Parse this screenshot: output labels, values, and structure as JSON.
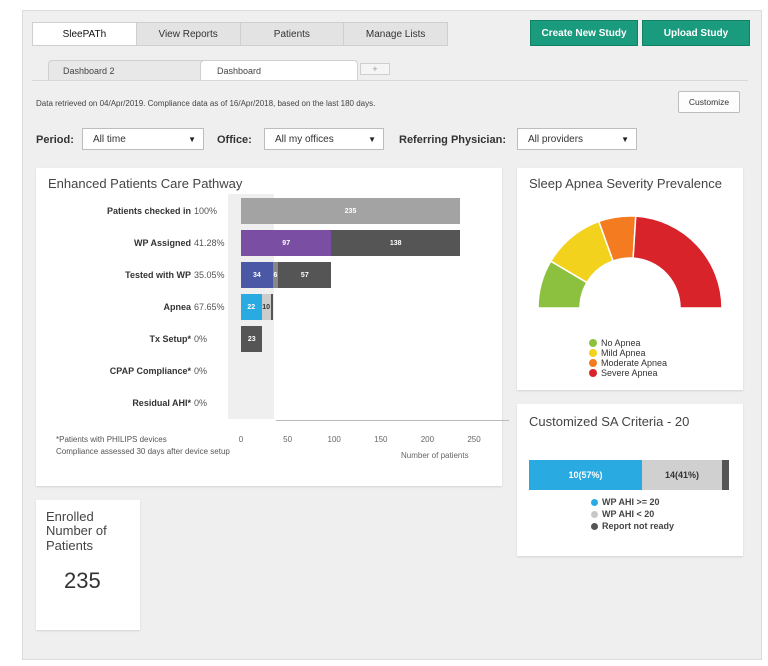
{
  "nav": {
    "tabs": [
      "SleePATh",
      "View Reports",
      "Patients",
      "Manage Lists"
    ],
    "create_study": "Create New Study",
    "upload_study": "Upload Study"
  },
  "dashboard_tabs": [
    "Dashboard 2",
    "Dashboard"
  ],
  "add_tab": "+",
  "info": "Data retrieved on 04/Apr/2019.  Compliance data as of 16/Apr/2018, based on the last 180 days.",
  "customize": "Customize",
  "filters": {
    "period_label": "Period:",
    "period_value": "All time",
    "office_label": "Office:",
    "office_value": "All my offices",
    "physician_label": "Referring Physician:",
    "physician_value": "All providers"
  },
  "pathway": {
    "title": "Enhanced Patients Care Pathway",
    "rows": [
      {
        "label": "Patients checked in",
        "pct": "100%",
        "segments": [
          {
            "value": 235,
            "label": "235"
          }
        ]
      },
      {
        "label": "WP Assigned",
        "pct": "41.28%",
        "segments": [
          {
            "value": 97,
            "label": "97"
          },
          {
            "value": 138,
            "label": "138"
          }
        ]
      },
      {
        "label": "Tested with WP",
        "pct": "35.05%",
        "segments": [
          {
            "value": 34,
            "label": "34"
          },
          {
            "value": 6,
            "label": "6"
          },
          {
            "value": 57,
            "label": "57"
          }
        ]
      },
      {
        "label": "Apnea",
        "pct": "67.65%",
        "segments": [
          {
            "value": 22,
            "label": "22"
          },
          {
            "value": 10,
            "label": "10"
          },
          {
            "value": 2,
            "label": ""
          }
        ]
      },
      {
        "label": "Tx Setup*",
        "pct": "0%",
        "segments": [
          {
            "value": 23,
            "label": "23"
          }
        ]
      },
      {
        "label": "CPAP Compliance*",
        "pct": "0%",
        "segments": []
      },
      {
        "label": "Residual AHI*",
        "pct": "0%",
        "segments": []
      }
    ],
    "ticks": [
      "0",
      "50",
      "100",
      "150",
      "200",
      "250"
    ],
    "xlabel": "Number of patients",
    "footnote1": "*Patients with PHILIPS devices",
    "footnote2": "Compliance assessed 30 days after device setup"
  },
  "enrolled": {
    "title": "Enrolled Number of Patients",
    "value": "235"
  },
  "severity": {
    "title": "Sleep Apnea Severity Prevalence",
    "legend": [
      {
        "label": "No Apnea",
        "color": "#8cc13f"
      },
      {
        "label": "Mild Apnea",
        "color": "#f2d21c"
      },
      {
        "label": "Moderate Apnea",
        "color": "#f47b20"
      },
      {
        "label": "Severe Apnea",
        "color": "#d8232a"
      }
    ]
  },
  "criteria": {
    "title": "Customized SA Criteria - 20",
    "bar": [
      {
        "label": "10(57%)",
        "color": "#29abe2"
      },
      {
        "label": "14(41%)",
        "color": "#d0d0d0"
      }
    ],
    "legend": [
      {
        "label": "WP AHI >= 20",
        "color": "#29abe2"
      },
      {
        "label": "WP AHI < 20",
        "color": "#c8c8c8"
      },
      {
        "label": "Report not ready",
        "color": "#555555"
      }
    ]
  },
  "chart_data": [
    {
      "type": "bar",
      "title": "Enhanced Patients Care Pathway",
      "orientation": "horizontal",
      "stacked": true,
      "categories": [
        "Patients checked in",
        "WP Assigned",
        "Tested with WP",
        "Apnea",
        "Tx Setup*",
        "CPAP Compliance*",
        "Residual AHI*"
      ],
      "series_values": [
        [
          235
        ],
        [
          97,
          138
        ],
        [
          34,
          6,
          57
        ],
        [
          22,
          10,
          2
        ],
        [
          23
        ],
        [],
        []
      ],
      "xlabel": "Number of patients",
      "xlim": [
        0,
        250
      ]
    },
    {
      "type": "pie",
      "title": "Sleep Apnea Severity Prevalence",
      "categories": [
        "No Apnea",
        "Mild Apnea",
        "Moderate Apnea",
        "Severe Apnea"
      ],
      "values": [
        17,
        22,
        13,
        48
      ],
      "legend": "bottom"
    },
    {
      "type": "bar",
      "title": "Customized SA Criteria - 20",
      "orientation": "horizontal",
      "stacked": true,
      "categories": [
        "WP AHI >= 20",
        "WP AHI < 20",
        "Report not ready"
      ],
      "values": [
        10,
        14,
        1
      ]
    }
  ]
}
